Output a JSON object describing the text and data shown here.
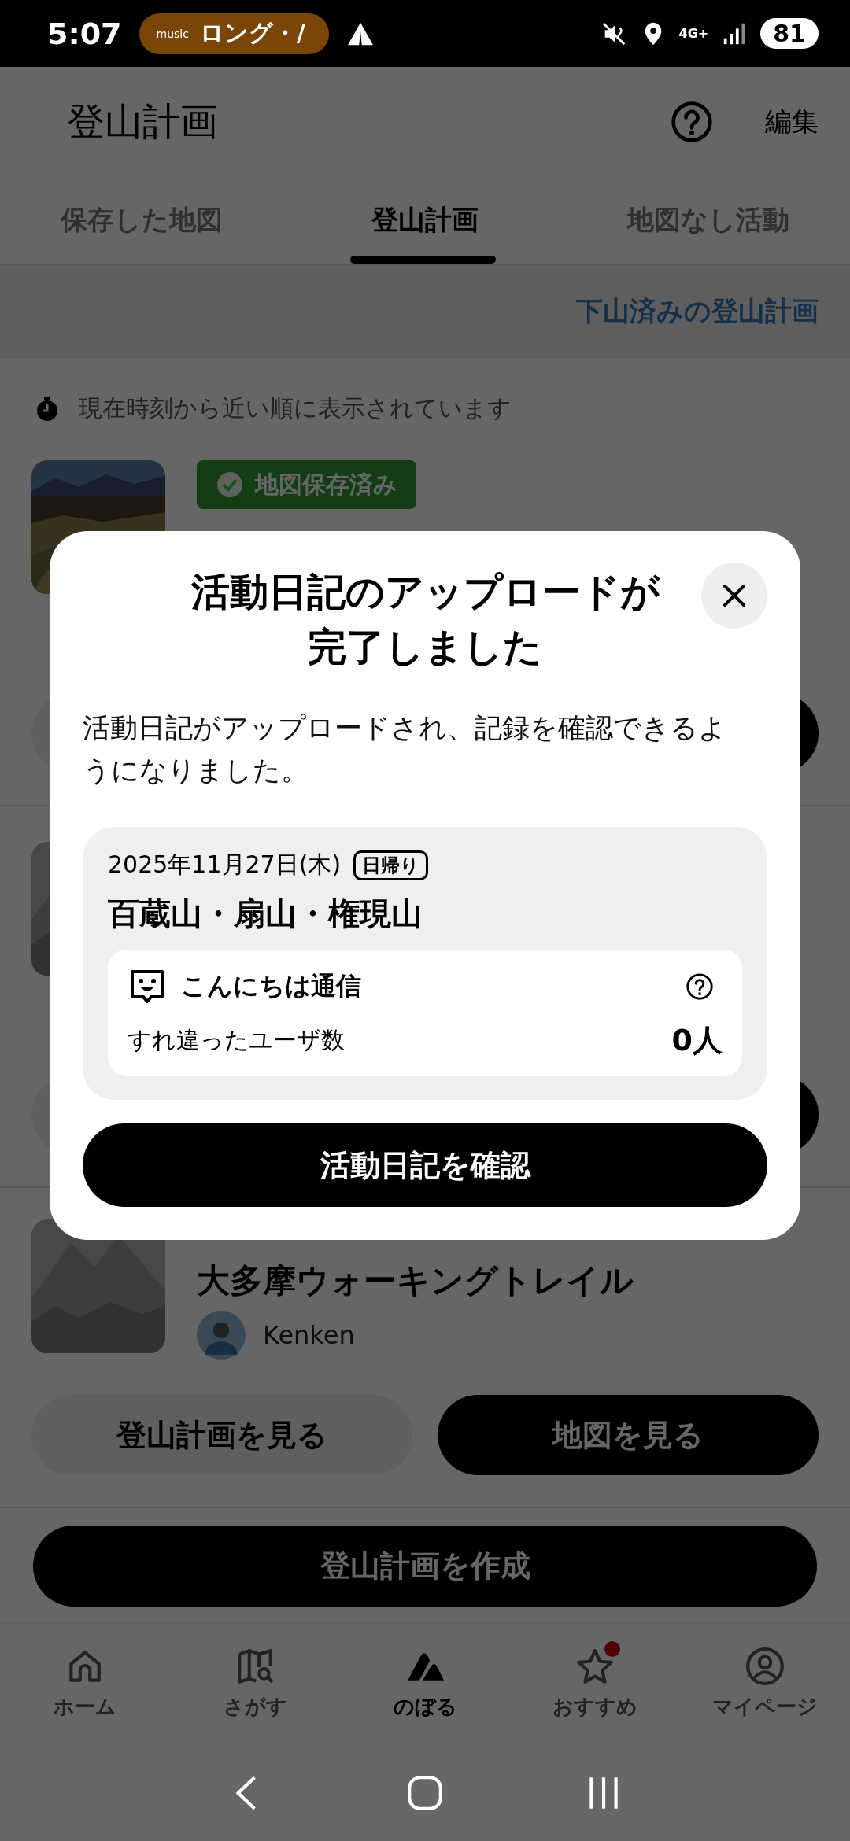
{
  "status_bar": {
    "time": "5:07",
    "media_chip": {
      "logo_text": "music",
      "title": "ロング・/"
    },
    "network": "4G+",
    "battery": "81"
  },
  "header": {
    "title": "登山計画",
    "edit": "編集"
  },
  "tabs": [
    {
      "label": "保存した地図",
      "selected": false
    },
    {
      "label": "登山計画",
      "selected": true
    },
    {
      "label": "地図なし活動",
      "selected": false
    }
  ],
  "done_link": "下山済みの登山計画",
  "notice": "現在時刻から近い順に表示されています",
  "plans": [
    {
      "badge": "地図保存済み"
    },
    {
      "kind": "placeholder"
    },
    {
      "kind": "placeholder",
      "title": "大多摩ウォーキングトレイル",
      "author": "Kenken",
      "buttons": [
        "登山計画を見る",
        "地図を見る"
      ]
    }
  ],
  "create_button": "登山計画を作成",
  "bottom_nav": [
    {
      "label": "ホーム",
      "kind": "home",
      "selected": false,
      "dot": false
    },
    {
      "label": "さがす",
      "kind": "map",
      "selected": false,
      "dot": false
    },
    {
      "label": "のぼる",
      "kind": "climb",
      "selected": true,
      "dot": false
    },
    {
      "label": "おすすめ",
      "kind": "star",
      "selected": false,
      "dot": true
    },
    {
      "label": "マイページ",
      "kind": "user",
      "selected": false,
      "dot": false
    }
  ],
  "dialog": {
    "title": "活動日記のアップロードが完了しました",
    "body": "活動日記がアップロードされ、記録を確認できるようになりました。",
    "activity": {
      "date": "2025年11月27日(木)",
      "tag": "日帰り",
      "name": "百蔵山・扇山・権現山",
      "greeting": {
        "title": "こんにちは通信",
        "label": "すれ違ったユーザ数",
        "value": "0人"
      }
    },
    "button": "活動日記を確認"
  }
}
